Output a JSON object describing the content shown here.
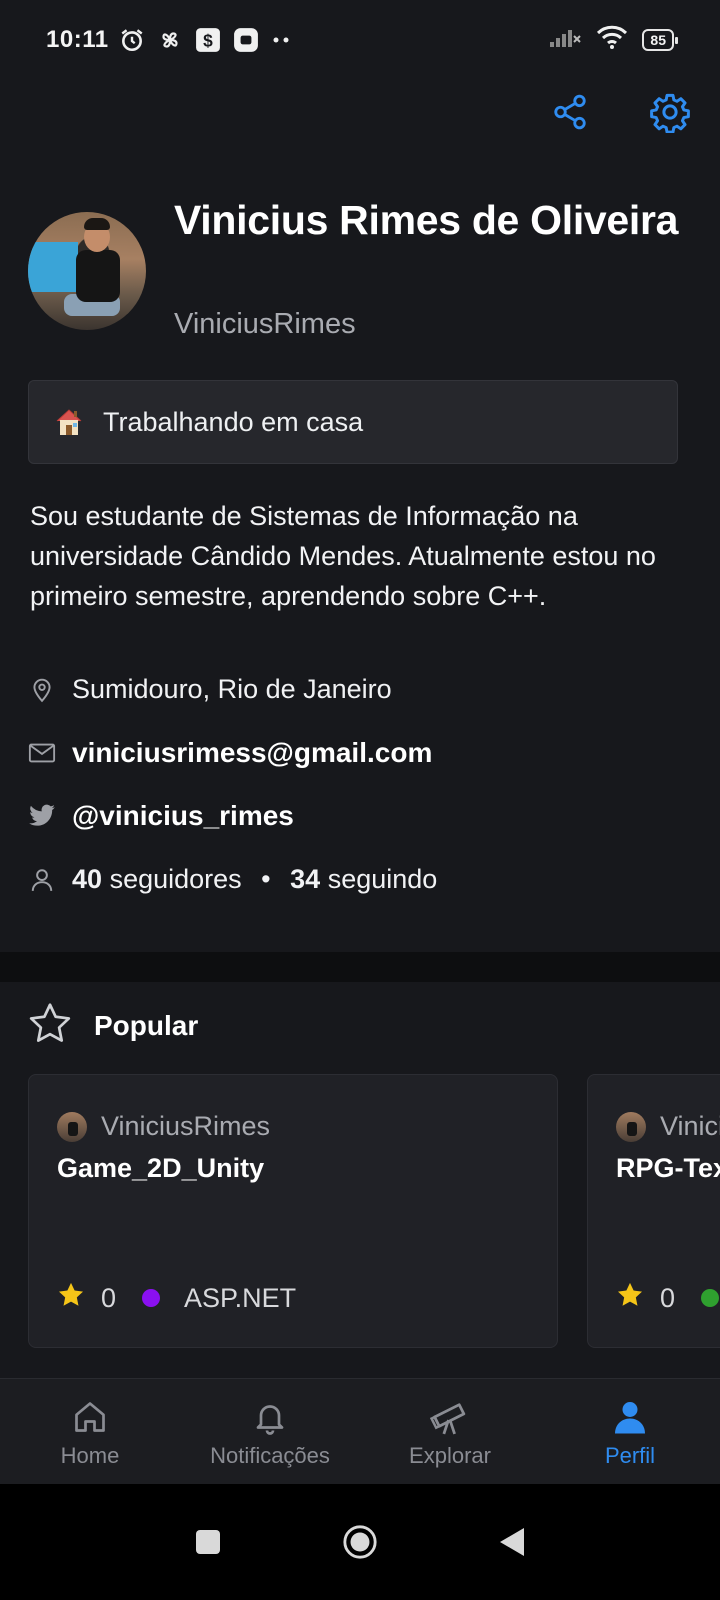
{
  "status_bar": {
    "time": "10:11",
    "battery": "85"
  },
  "profile": {
    "name": "Vinicius Rimes de Oliveira",
    "login": "ViniciusRimes",
    "status": "Trabalhando em casa",
    "bio": "Sou estudante de Sistemas de Informação na universidade Cândido Mendes. Atualmente estou no primeiro semestre, aprendendo sobre C++.",
    "location": "Sumidouro, Rio de Janeiro",
    "email": "viniciusrimess@gmail.com",
    "twitter": "@vinicius_rimes",
    "followers_count": "40",
    "followers_label": "seguidores",
    "separator": "•",
    "following_count": "34",
    "following_label": "seguindo"
  },
  "popular": {
    "title": "Popular",
    "repos": [
      {
        "owner": "ViniciusRimes",
        "name": "Game_2D_Unity",
        "stars": "0",
        "language": "ASP.NET",
        "language_color": "#8a10f0"
      },
      {
        "owner": "ViniciusRimes",
        "name": "RPG-Text",
        "stars": "0",
        "language": "",
        "language_color": "#2fa02f"
      }
    ]
  },
  "bottom_nav": {
    "items": [
      {
        "label": "Home",
        "icon": "home-icon"
      },
      {
        "label": "Notificações",
        "icon": "bell-icon"
      },
      {
        "label": "Explorar",
        "icon": "telescope-icon"
      },
      {
        "label": "Perfil",
        "icon": "person-icon"
      }
    ],
    "active": "Perfil"
  },
  "colors": {
    "background": "#17181c",
    "accent": "#2f8cf0",
    "star": "#f5c518"
  }
}
